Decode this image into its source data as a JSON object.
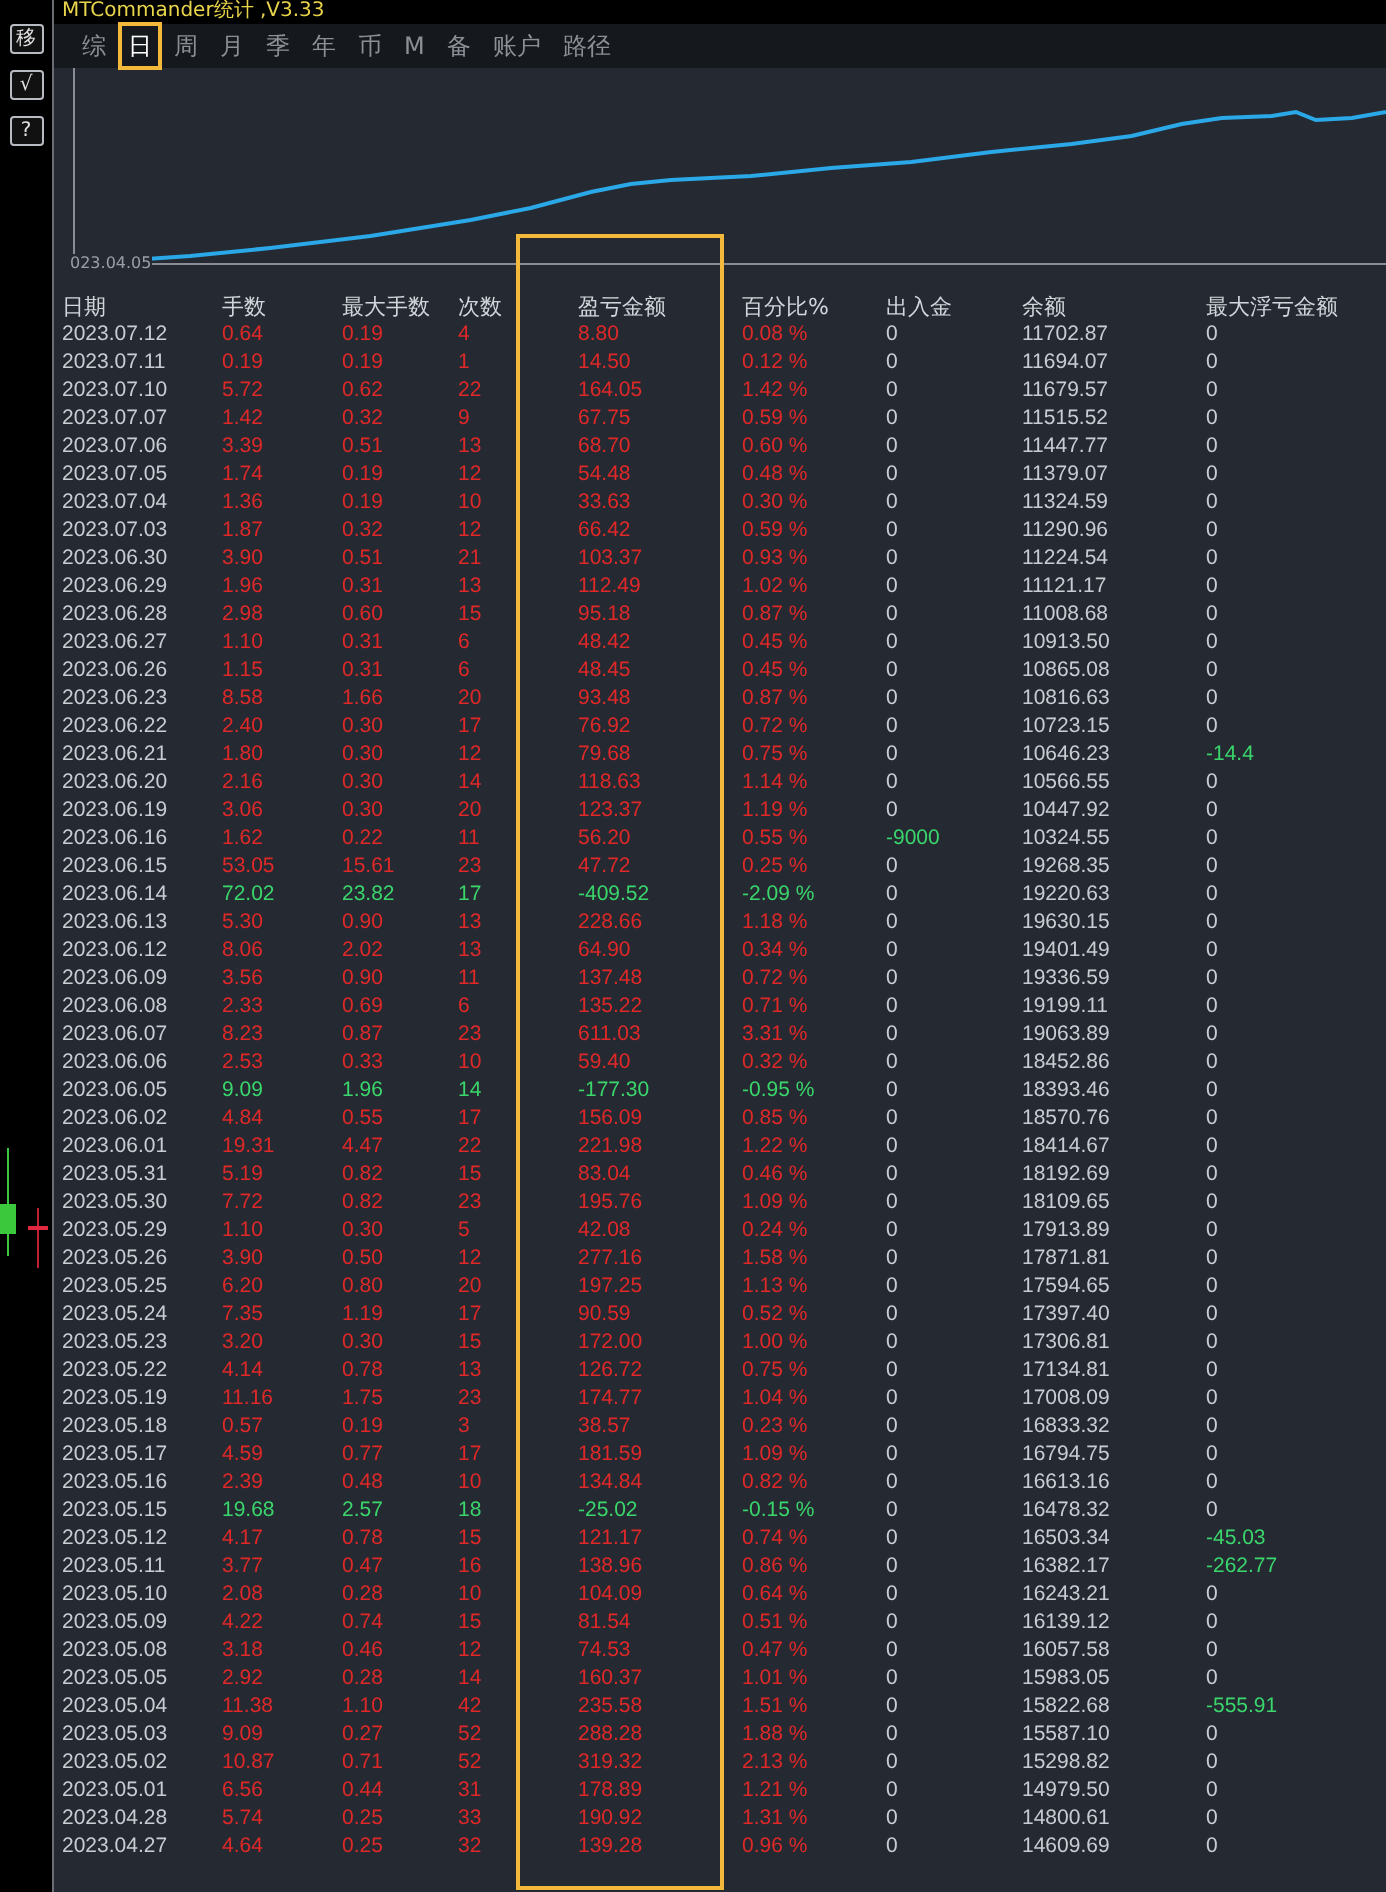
{
  "window": {
    "title": "MTCommander统计 ,V3.33"
  },
  "side_buttons": [
    "移",
    "√",
    "?"
  ],
  "tabs": [
    {
      "label": "综",
      "selected": false
    },
    {
      "label": "日",
      "selected": true
    },
    {
      "label": "周",
      "selected": false
    },
    {
      "label": "月",
      "selected": false
    },
    {
      "label": "季",
      "selected": false
    },
    {
      "label": "年",
      "selected": false
    },
    {
      "label": "币",
      "selected": false
    },
    {
      "label": "M",
      "selected": false
    },
    {
      "label": "备",
      "selected": false
    },
    {
      "label": "账户",
      "selected": false
    },
    {
      "label": "路径",
      "selected": false
    }
  ],
  "chart": {
    "start_label": "023.04.05"
  },
  "table": {
    "columns": [
      "日期",
      "手数",
      "最大手数",
      "次数",
      "盈亏金额",
      "百分比%",
      "出入金",
      "余额",
      "最大浮亏金额"
    ],
    "rows": [
      {
        "date": "2023.07.12",
        "lots": "0.64",
        "max_lots": "0.19",
        "trades": "4",
        "pnl": "8.80",
        "pct": "0.08 %",
        "deposit": "0",
        "balance": "11702.87",
        "max_float": "0",
        "color": "#e02828",
        "deposit_negative": false,
        "float_negative": false
      },
      {
        "date": "2023.07.11",
        "lots": "0.19",
        "max_lots": "0.19",
        "trades": "1",
        "pnl": "14.50",
        "pct": "0.12 %",
        "deposit": "0",
        "balance": "11694.07",
        "max_float": "0",
        "color": "#e02828",
        "deposit_negative": false,
        "float_negative": false
      },
      {
        "date": "2023.07.10",
        "lots": "5.72",
        "max_lots": "0.62",
        "trades": "22",
        "pnl": "164.05",
        "pct": "1.42 %",
        "deposit": "0",
        "balance": "11679.57",
        "max_float": "0",
        "color": "#e02828",
        "deposit_negative": false,
        "float_negative": false
      },
      {
        "date": "2023.07.07",
        "lots": "1.42",
        "max_lots": "0.32",
        "trades": "9",
        "pnl": "67.75",
        "pct": "0.59 %",
        "deposit": "0",
        "balance": "11515.52",
        "max_float": "0",
        "color": "#e02828",
        "deposit_negative": false,
        "float_negative": false
      },
      {
        "date": "2023.07.06",
        "lots": "3.39",
        "max_lots": "0.51",
        "trades": "13",
        "pnl": "68.70",
        "pct": "0.60 %",
        "deposit": "0",
        "balance": "11447.77",
        "max_float": "0",
        "color": "#e02828",
        "deposit_negative": false,
        "float_negative": false
      },
      {
        "date": "2023.07.05",
        "lots": "1.74",
        "max_lots": "0.19",
        "trades": "12",
        "pnl": "54.48",
        "pct": "0.48 %",
        "deposit": "0",
        "balance": "11379.07",
        "max_float": "0",
        "color": "#e02828",
        "deposit_negative": false,
        "float_negative": false
      },
      {
        "date": "2023.07.04",
        "lots": "1.36",
        "max_lots": "0.19",
        "trades": "10",
        "pnl": "33.63",
        "pct": "0.30 %",
        "deposit": "0",
        "balance": "11324.59",
        "max_float": "0",
        "color": "#e02828",
        "deposit_negative": false,
        "float_negative": false
      },
      {
        "date": "2023.07.03",
        "lots": "1.87",
        "max_lots": "0.32",
        "trades": "12",
        "pnl": "66.42",
        "pct": "0.59 %",
        "deposit": "0",
        "balance": "11290.96",
        "max_float": "0",
        "color": "#e02828",
        "deposit_negative": false,
        "float_negative": false
      },
      {
        "date": "2023.06.30",
        "lots": "3.90",
        "max_lots": "0.51",
        "trades": "21",
        "pnl": "103.37",
        "pct": "0.93 %",
        "deposit": "0",
        "balance": "11224.54",
        "max_float": "0",
        "color": "#e02828",
        "deposit_negative": false,
        "float_negative": false
      },
      {
        "date": "2023.06.29",
        "lots": "1.96",
        "max_lots": "0.31",
        "trades": "13",
        "pnl": "112.49",
        "pct": "1.02 %",
        "deposit": "0",
        "balance": "11121.17",
        "max_float": "0",
        "color": "#e02828",
        "deposit_negative": false,
        "float_negative": false
      },
      {
        "date": "2023.06.28",
        "lots": "2.98",
        "max_lots": "0.60",
        "trades": "15",
        "pnl": "95.18",
        "pct": "0.87 %",
        "deposit": "0",
        "balance": "11008.68",
        "max_float": "0",
        "color": "#e02828",
        "deposit_negative": false,
        "float_negative": false
      },
      {
        "date": "2023.06.27",
        "lots": "1.10",
        "max_lots": "0.31",
        "trades": "6",
        "pnl": "48.42",
        "pct": "0.45 %",
        "deposit": "0",
        "balance": "10913.50",
        "max_float": "0",
        "color": "#e02828",
        "deposit_negative": false,
        "float_negative": false
      },
      {
        "date": "2023.06.26",
        "lots": "1.15",
        "max_lots": "0.31",
        "trades": "6",
        "pnl": "48.45",
        "pct": "0.45 %",
        "deposit": "0",
        "balance": "10865.08",
        "max_float": "0",
        "color": "#e02828",
        "deposit_negative": false,
        "float_negative": false
      },
      {
        "date": "2023.06.23",
        "lots": "8.58",
        "max_lots": "1.66",
        "trades": "20",
        "pnl": "93.48",
        "pct": "0.87 %",
        "deposit": "0",
        "balance": "10816.63",
        "max_float": "0",
        "color": "#e02828",
        "deposit_negative": false,
        "float_negative": false
      },
      {
        "date": "2023.06.22",
        "lots": "2.40",
        "max_lots": "0.30",
        "trades": "17",
        "pnl": "76.92",
        "pct": "0.72 %",
        "deposit": "0",
        "balance": "10723.15",
        "max_float": "0",
        "color": "#e02828",
        "deposit_negative": false,
        "float_negative": false
      },
      {
        "date": "2023.06.21",
        "lots": "1.80",
        "max_lots": "0.30",
        "trades": "12",
        "pnl": "79.68",
        "pct": "0.75 %",
        "deposit": "0",
        "balance": "10646.23",
        "max_float": "-14.4",
        "color": "#e02828",
        "deposit_negative": false,
        "float_negative": true
      },
      {
        "date": "2023.06.20",
        "lots": "2.16",
        "max_lots": "0.30",
        "trades": "14",
        "pnl": "118.63",
        "pct": "1.14 %",
        "deposit": "0",
        "balance": "10566.55",
        "max_float": "0",
        "color": "#e02828",
        "deposit_negative": false,
        "float_negative": false
      },
      {
        "date": "2023.06.19",
        "lots": "3.06",
        "max_lots": "0.30",
        "trades": "20",
        "pnl": "123.37",
        "pct": "1.19 %",
        "deposit": "0",
        "balance": "10447.92",
        "max_float": "0",
        "color": "#e02828",
        "deposit_negative": false,
        "float_negative": false
      },
      {
        "date": "2023.06.16",
        "lots": "1.62",
        "max_lots": "0.22",
        "trades": "11",
        "pnl": "56.20",
        "pct": "0.55 %",
        "deposit": "-9000",
        "balance": "10324.55",
        "max_float": "0",
        "color": "#e02828",
        "deposit_negative": true,
        "float_negative": false
      },
      {
        "date": "2023.06.15",
        "lots": "53.05",
        "max_lots": "15.61",
        "trades": "23",
        "pnl": "47.72",
        "pct": "0.25 %",
        "deposit": "0",
        "balance": "19268.35",
        "max_float": "0",
        "color": "#e02828",
        "deposit_negative": false,
        "float_negative": false
      },
      {
        "date": "2023.06.14",
        "lots": "72.02",
        "max_lots": "23.82",
        "trades": "17",
        "pnl": "-409.52",
        "pct": "-2.09 %",
        "deposit": "0",
        "balance": "19220.63",
        "max_float": "0",
        "color": "#3ad66c",
        "deposit_negative": false,
        "float_negative": false
      },
      {
        "date": "2023.06.13",
        "lots": "5.30",
        "max_lots": "0.90",
        "trades": "13",
        "pnl": "228.66",
        "pct": "1.18 %",
        "deposit": "0",
        "balance": "19630.15",
        "max_float": "0",
        "color": "#e02828",
        "deposit_negative": false,
        "float_negative": false
      },
      {
        "date": "2023.06.12",
        "lots": "8.06",
        "max_lots": "2.02",
        "trades": "13",
        "pnl": "64.90",
        "pct": "0.34 %",
        "deposit": "0",
        "balance": "19401.49",
        "max_float": "0",
        "color": "#e02828",
        "deposit_negative": false,
        "float_negative": false
      },
      {
        "date": "2023.06.09",
        "lots": "3.56",
        "max_lots": "0.90",
        "trades": "11",
        "pnl": "137.48",
        "pct": "0.72 %",
        "deposit": "0",
        "balance": "19336.59",
        "max_float": "0",
        "color": "#e02828",
        "deposit_negative": false,
        "float_negative": false
      },
      {
        "date": "2023.06.08",
        "lots": "2.33",
        "max_lots": "0.69",
        "trades": "6",
        "pnl": "135.22",
        "pct": "0.71 %",
        "deposit": "0",
        "balance": "19199.11",
        "max_float": "0",
        "color": "#e02828",
        "deposit_negative": false,
        "float_negative": false
      },
      {
        "date": "2023.06.07",
        "lots": "8.23",
        "max_lots": "0.87",
        "trades": "23",
        "pnl": "611.03",
        "pct": "3.31 %",
        "deposit": "0",
        "balance": "19063.89",
        "max_float": "0",
        "color": "#e02828",
        "deposit_negative": false,
        "float_negative": false
      },
      {
        "date": "2023.06.06",
        "lots": "2.53",
        "max_lots": "0.33",
        "trades": "10",
        "pnl": "59.40",
        "pct": "0.32 %",
        "deposit": "0",
        "balance": "18452.86",
        "max_float": "0",
        "color": "#e02828",
        "deposit_negative": false,
        "float_negative": false
      },
      {
        "date": "2023.06.05",
        "lots": "9.09",
        "max_lots": "1.96",
        "trades": "14",
        "pnl": "-177.30",
        "pct": "-0.95 %",
        "deposit": "0",
        "balance": "18393.46",
        "max_float": "0",
        "color": "#3ad66c",
        "deposit_negative": false,
        "float_negative": false
      },
      {
        "date": "2023.06.02",
        "lots": "4.84",
        "max_lots": "0.55",
        "trades": "17",
        "pnl": "156.09",
        "pct": "0.85 %",
        "deposit": "0",
        "balance": "18570.76",
        "max_float": "0",
        "color": "#e02828",
        "deposit_negative": false,
        "float_negative": false
      },
      {
        "date": "2023.06.01",
        "lots": "19.31",
        "max_lots": "4.47",
        "trades": "22",
        "pnl": "221.98",
        "pct": "1.22 %",
        "deposit": "0",
        "balance": "18414.67",
        "max_float": "0",
        "color": "#e02828",
        "deposit_negative": false,
        "float_negative": false
      },
      {
        "date": "2023.05.31",
        "lots": "5.19",
        "max_lots": "0.82",
        "trades": "15",
        "pnl": "83.04",
        "pct": "0.46 %",
        "deposit": "0",
        "balance": "18192.69",
        "max_float": "0",
        "color": "#e02828",
        "deposit_negative": false,
        "float_negative": false
      },
      {
        "date": "2023.05.30",
        "lots": "7.72",
        "max_lots": "0.82",
        "trades": "23",
        "pnl": "195.76",
        "pct": "1.09 %",
        "deposit": "0",
        "balance": "18109.65",
        "max_float": "0",
        "color": "#e02828",
        "deposit_negative": false,
        "float_negative": false
      },
      {
        "date": "2023.05.29",
        "lots": "1.10",
        "max_lots": "0.30",
        "trades": "5",
        "pnl": "42.08",
        "pct": "0.24 %",
        "deposit": "0",
        "balance": "17913.89",
        "max_float": "0",
        "color": "#e02828",
        "deposit_negative": false,
        "float_negative": false
      },
      {
        "date": "2023.05.26",
        "lots": "3.90",
        "max_lots": "0.50",
        "trades": "12",
        "pnl": "277.16",
        "pct": "1.58 %",
        "deposit": "0",
        "balance": "17871.81",
        "max_float": "0",
        "color": "#e02828",
        "deposit_negative": false,
        "float_negative": false
      },
      {
        "date": "2023.05.25",
        "lots": "6.20",
        "max_lots": "0.80",
        "trades": "20",
        "pnl": "197.25",
        "pct": "1.13 %",
        "deposit": "0",
        "balance": "17594.65",
        "max_float": "0",
        "color": "#e02828",
        "deposit_negative": false,
        "float_negative": false
      },
      {
        "date": "2023.05.24",
        "lots": "7.35",
        "max_lots": "1.19",
        "trades": "17",
        "pnl": "90.59",
        "pct": "0.52 %",
        "deposit": "0",
        "balance": "17397.40",
        "max_float": "0",
        "color": "#e02828",
        "deposit_negative": false,
        "float_negative": false
      },
      {
        "date": "2023.05.23",
        "lots": "3.20",
        "max_lots": "0.30",
        "trades": "15",
        "pnl": "172.00",
        "pct": "1.00 %",
        "deposit": "0",
        "balance": "17306.81",
        "max_float": "0",
        "color": "#e02828",
        "deposit_negative": false,
        "float_negative": false
      },
      {
        "date": "2023.05.22",
        "lots": "4.14",
        "max_lots": "0.78",
        "trades": "13",
        "pnl": "126.72",
        "pct": "0.75 %",
        "deposit": "0",
        "balance": "17134.81",
        "max_float": "0",
        "color": "#e02828",
        "deposit_negative": false,
        "float_negative": false
      },
      {
        "date": "2023.05.19",
        "lots": "11.16",
        "max_lots": "1.75",
        "trades": "23",
        "pnl": "174.77",
        "pct": "1.04 %",
        "deposit": "0",
        "balance": "17008.09",
        "max_float": "0",
        "color": "#e02828",
        "deposit_negative": false,
        "float_negative": false
      },
      {
        "date": "2023.05.18",
        "lots": "0.57",
        "max_lots": "0.19",
        "trades": "3",
        "pnl": "38.57",
        "pct": "0.23 %",
        "deposit": "0",
        "balance": "16833.32",
        "max_float": "0",
        "color": "#e02828",
        "deposit_negative": false,
        "float_negative": false
      },
      {
        "date": "2023.05.17",
        "lots": "4.59",
        "max_lots": "0.77",
        "trades": "17",
        "pnl": "181.59",
        "pct": "1.09 %",
        "deposit": "0",
        "balance": "16794.75",
        "max_float": "0",
        "color": "#e02828",
        "deposit_negative": false,
        "float_negative": false
      },
      {
        "date": "2023.05.16",
        "lots": "2.39",
        "max_lots": "0.48",
        "trades": "10",
        "pnl": "134.84",
        "pct": "0.82 %",
        "deposit": "0",
        "balance": "16613.16",
        "max_float": "0",
        "color": "#e02828",
        "deposit_negative": false,
        "float_negative": false
      },
      {
        "date": "2023.05.15",
        "lots": "19.68",
        "max_lots": "2.57",
        "trades": "18",
        "pnl": "-25.02",
        "pct": "-0.15 %",
        "deposit": "0",
        "balance": "16478.32",
        "max_float": "0",
        "color": "#3ad66c",
        "deposit_negative": false,
        "float_negative": false
      },
      {
        "date": "2023.05.12",
        "lots": "4.17",
        "max_lots": "0.78",
        "trades": "15",
        "pnl": "121.17",
        "pct": "0.74 %",
        "deposit": "0",
        "balance": "16503.34",
        "max_float": "-45.03",
        "color": "#e02828",
        "deposit_negative": false,
        "float_negative": true
      },
      {
        "date": "2023.05.11",
        "lots": "3.77",
        "max_lots": "0.47",
        "trades": "16",
        "pnl": "138.96",
        "pct": "0.86 %",
        "deposit": "0",
        "balance": "16382.17",
        "max_float": "-262.77",
        "color": "#e02828",
        "deposit_negative": false,
        "float_negative": true
      },
      {
        "date": "2023.05.10",
        "lots": "2.08",
        "max_lots": "0.28",
        "trades": "10",
        "pnl": "104.09",
        "pct": "0.64 %",
        "deposit": "0",
        "balance": "16243.21",
        "max_float": "0",
        "color": "#e02828",
        "deposit_negative": false,
        "float_negative": false
      },
      {
        "date": "2023.05.09",
        "lots": "4.22",
        "max_lots": "0.74",
        "trades": "15",
        "pnl": "81.54",
        "pct": "0.51 %",
        "deposit": "0",
        "balance": "16139.12",
        "max_float": "0",
        "color": "#e02828",
        "deposit_negative": false,
        "float_negative": false
      },
      {
        "date": "2023.05.08",
        "lots": "3.18",
        "max_lots": "0.46",
        "trades": "12",
        "pnl": "74.53",
        "pct": "0.47 %",
        "deposit": "0",
        "balance": "16057.58",
        "max_float": "0",
        "color": "#e02828",
        "deposit_negative": false,
        "float_negative": false
      },
      {
        "date": "2023.05.05",
        "lots": "2.92",
        "max_lots": "0.28",
        "trades": "14",
        "pnl": "160.37",
        "pct": "1.01 %",
        "deposit": "0",
        "balance": "15983.05",
        "max_float": "0",
        "color": "#e02828",
        "deposit_negative": false,
        "float_negative": false
      },
      {
        "date": "2023.05.04",
        "lots": "11.38",
        "max_lots": "1.10",
        "trades": "42",
        "pnl": "235.58",
        "pct": "1.51 %",
        "deposit": "0",
        "balance": "15822.68",
        "max_float": "-555.91",
        "color": "#e02828",
        "deposit_negative": false,
        "float_negative": true
      },
      {
        "date": "2023.05.03",
        "lots": "9.09",
        "max_lots": "0.27",
        "trades": "52",
        "pnl": "288.28",
        "pct": "1.88 %",
        "deposit": "0",
        "balance": "15587.10",
        "max_float": "0",
        "color": "#e02828",
        "deposit_negative": false,
        "float_negative": false
      },
      {
        "date": "2023.05.02",
        "lots": "10.87",
        "max_lots": "0.71",
        "trades": "52",
        "pnl": "319.32",
        "pct": "2.13 %",
        "deposit": "0",
        "balance": "15298.82",
        "max_float": "0",
        "color": "#e02828",
        "deposit_negative": false,
        "float_negative": false
      },
      {
        "date": "2023.05.01",
        "lots": "6.56",
        "max_lots": "0.44",
        "trades": "31",
        "pnl": "178.89",
        "pct": "1.21 %",
        "deposit": "0",
        "balance": "14979.50",
        "max_float": "0",
        "color": "#e02828",
        "deposit_negative": false,
        "float_negative": false
      },
      {
        "date": "2023.04.28",
        "lots": "5.74",
        "max_lots": "0.25",
        "trades": "33",
        "pnl": "190.92",
        "pct": "1.31 %",
        "deposit": "0",
        "balance": "14800.61",
        "max_float": "0",
        "color": "#e02828",
        "deposit_negative": false,
        "float_negative": false
      },
      {
        "date": "2023.04.27",
        "lots": "4.64",
        "max_lots": "0.25",
        "trades": "32",
        "pnl": "139.28",
        "pct": "0.96 %",
        "deposit": "0",
        "balance": "14609.69",
        "max_float": "0",
        "color": "#e02828",
        "deposit_negative": false,
        "float_negative": false
      }
    ]
  }
}
